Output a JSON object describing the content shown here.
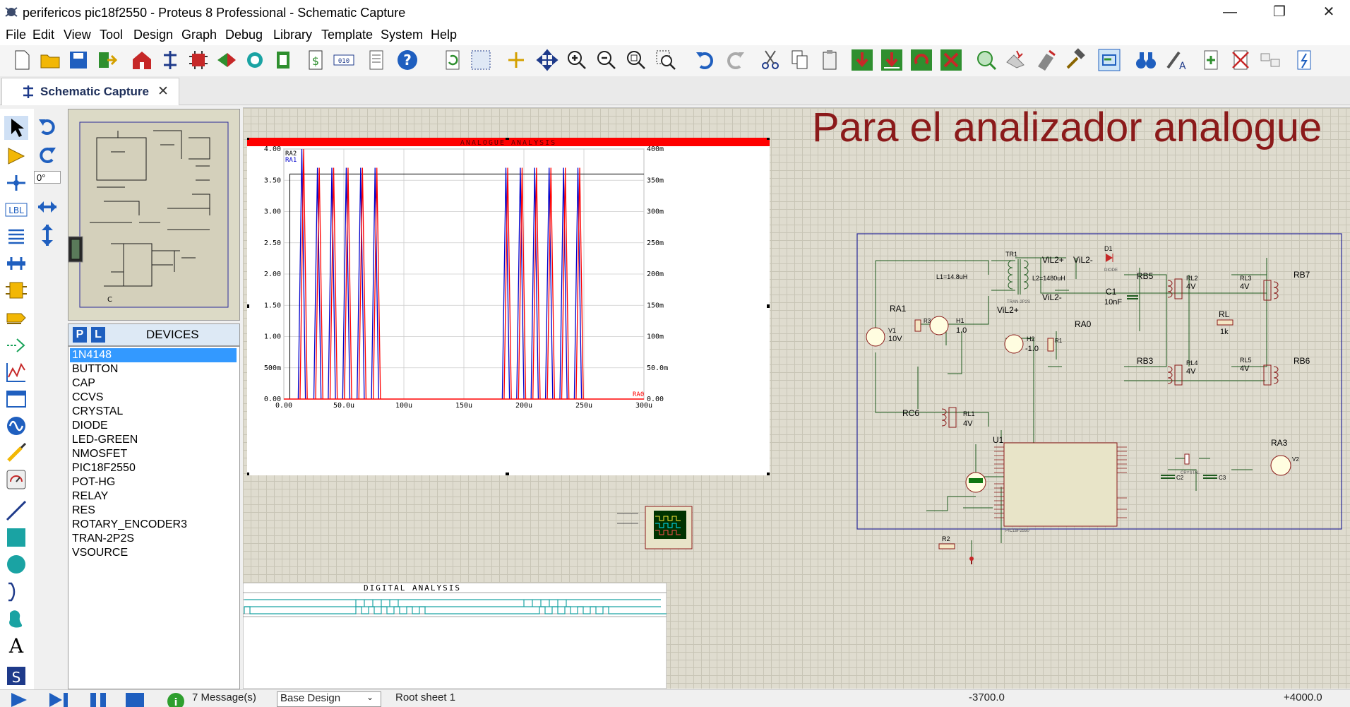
{
  "window": {
    "title": "perifericos pic18f2550 - Proteus 8 Professional - Schematic Capture",
    "minimize": "—",
    "maximize": "❐",
    "close": "✕"
  },
  "menu": [
    "File",
    "Edit",
    "View",
    "Tool",
    "Design",
    "Graph",
    "Debug",
    "Library",
    "Template",
    "System",
    "Help"
  ],
  "tab": {
    "label": "Schematic Capture",
    "close": "✕"
  },
  "rotation": "0°",
  "devices": {
    "p_btn": "P",
    "l_btn": "L",
    "header": "DEVICES",
    "items": [
      "1N4148",
      "BUTTON",
      "CAP",
      "CCVS",
      "CRYSTAL",
      "DIODE",
      "LED-GREEN",
      "NMOSFET",
      "PIC18F2550",
      "POT-HG",
      "RELAY",
      "RES",
      "ROTARY_ENCODER3",
      "TRAN-2P2S",
      "VSOURCE"
    ],
    "selected": "1N4148"
  },
  "canvas": {
    "heading": "Para el analizador analogue",
    "digital_title": "DIGITAL ANALYSIS",
    "schematic_labels": {
      "tr1": "TR1",
      "l1": "L1=14.8uH",
      "l2": "L2=1480uH",
      "tran": "TRAN-2P2S",
      "vil2p": "ViL2+",
      "vil2m": "ViL2-",
      "vil2m_out": "ViL2-",
      "vil2p_b": "ViL2+",
      "d1": "D1",
      "d1_part": "DIODE",
      "c1": "C1",
      "c1v": "10nF",
      "ra1": "RA1",
      "r3": "R3",
      "h1": "H1",
      "h1v": "1.0",
      "v1": "V1",
      "v1v": "10V",
      "h2": "H2",
      "h2v": "-1.0",
      "r1": "R1",
      "ra0": "RA0",
      "rc6": "RC6",
      "rl1": "RL1",
      "rl1v": "4V",
      "rb5": "RB5",
      "rl2": "RL2",
      "rl2v": "4V",
      "rl3": "RL3",
      "rl3v": "4V",
      "rb7": "RB7",
      "rl": "RL",
      "rlv": "1k",
      "rb3": "RB3",
      "rl4": "RL4",
      "rl4v": "4V",
      "rl5": "RL5",
      "rl5v": "4V",
      "rb6": "RB6",
      "u1": "U1",
      "u1_part": "PIC18F2550",
      "ra3": "RA3",
      "v2": "V2",
      "c2": "C2",
      "c3": "C3",
      "crystal": "CRYSTAL",
      "r2": "R2"
    }
  },
  "chart_data": {
    "type": "line",
    "title": "ANALOGUE ANALYSIS",
    "x_ticks": [
      "0.00",
      "50.0u",
      "100u",
      "150u",
      "200u",
      "250u",
      "300u"
    ],
    "y_left_ticks": [
      "0.00",
      "500m",
      "1.00",
      "1.50",
      "2.00",
      "2.50",
      "3.00",
      "3.50",
      "4.00"
    ],
    "y_right_ticks": [
      "0.00",
      "50.0m",
      "100m",
      "150m",
      "200m",
      "250m",
      "300m",
      "350m",
      "400m"
    ],
    "xlim": [
      0,
      0.0003
    ],
    "ylim": [
      0,
      4.0
    ],
    "series": [
      {
        "name": "RA2",
        "color": "#000000"
      },
      {
        "name": "RA1",
        "color": "#0000cc"
      },
      {
        "name": "RA0",
        "color": "#ff0000"
      }
    ],
    "ra2_level": 3.6,
    "pulse_groups": [
      {
        "starts_us": [
          12,
          25,
          37,
          49,
          61,
          73
        ]
      },
      {
        "starts_us": [
          182,
          194,
          206,
          218,
          230,
          242
        ]
      }
    ],
    "pulse_peak": 3.7,
    "first_peak": 4.0,
    "grid": true
  },
  "status": {
    "messages": "7 Message(s)",
    "design": "Base Design",
    "sheet": "Root sheet 1",
    "coord_x": "-3700.0",
    "coord_y": "+4000.0"
  },
  "colors": {
    "accent": "#0078d7",
    "graph_title_bar": "#ff0000",
    "heading": "#8b1a1a",
    "schematic_line": "#1e5a1e",
    "sheet_border": "#2a2a9a"
  }
}
